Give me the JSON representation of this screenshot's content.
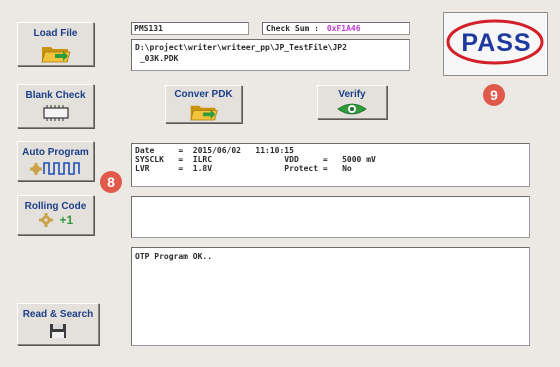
{
  "buttons": {
    "load_file": "Load File",
    "blank_check": "Blank Check",
    "convert_pdk": "Conver PDK",
    "verify": "Verify",
    "auto_program": "Auto Program",
    "rolling_code": "Rolling Code",
    "rolling_code_increment": "+1",
    "read_search": "Read & Search"
  },
  "file": {
    "chip": "PMS131",
    "checksum_label": "Check Sum :",
    "checksum_value": "0xF1A46",
    "path_line1": "D:\\project\\writer\\writeer_pp\\JP_TestFile\\JP2",
    "path_line2": " _03K.PDK"
  },
  "result": {
    "status": "PASS",
    "colors": {
      "ring": "#d21f2a",
      "text": "#1f3a9e"
    }
  },
  "info": {
    "line1": "Date     =  2015/06/02   11:10:15",
    "line2": "SYSCLK   =  ILRC               VDD     =   5000 mV",
    "line3": "LVR      =  1.8V               Protect =   No"
  },
  "log": {
    "message": "OTP Program OK.."
  },
  "markers": {
    "auto_program": "8",
    "pass": "9"
  },
  "icons": {
    "load_file": "folder-icon",
    "blank_check": "chip-icon",
    "convert_pdk": "folder-icon",
    "verify": "eye-icon",
    "auto_program": "waveform-icon",
    "rolling_code": "gear-icon",
    "read_search": "floppy-disk-icon"
  }
}
